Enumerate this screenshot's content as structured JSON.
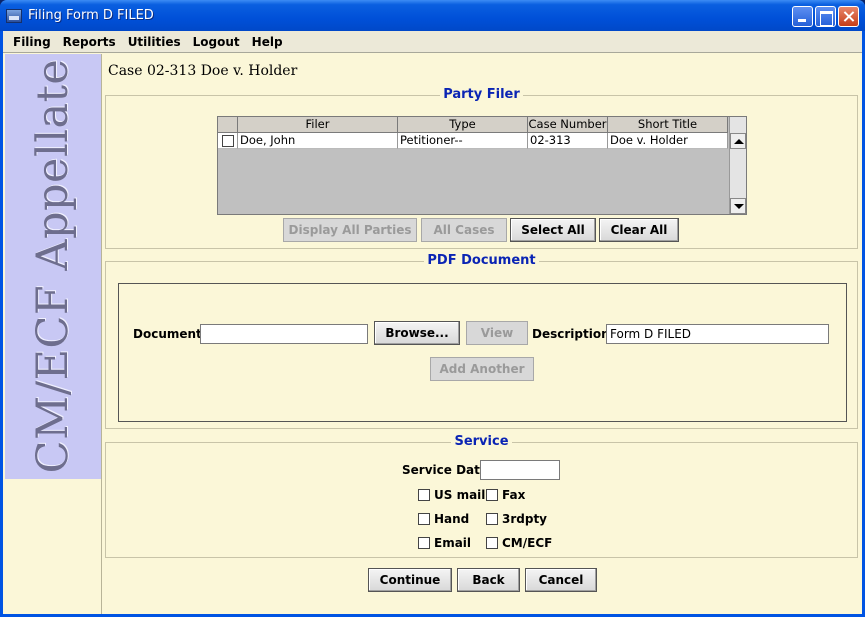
{
  "window": {
    "title": "Filing Form D FILED"
  },
  "menu": [
    "Filing",
    "Reports",
    "Utilities",
    "Logout",
    "Help"
  ],
  "sidebar": {
    "text": "CM/ECF Appellate"
  },
  "case_title": "Case 02-313 Doe v. Holder",
  "party_filer": {
    "legend": "Party Filer",
    "columns": [
      "",
      "Filer",
      "Type",
      "Case Number",
      "Short Title"
    ],
    "rows": [
      {
        "checked": false,
        "filer": "Doe, John",
        "type": "Petitioner--",
        "case_number": "02-313",
        "short_title": "Doe v. Holder"
      }
    ],
    "buttons": {
      "display_all_parties": "Display All Parties",
      "all_cases": "All Cases",
      "select_all": "Select All",
      "clear_all": "Clear All"
    }
  },
  "pdf_document": {
    "legend": "PDF Document",
    "document_label": "Document:",
    "document_value": "",
    "browse": "Browse...",
    "view": "View",
    "description_label": "Description:",
    "description_value": "Form D FILED",
    "add_another": "Add Another"
  },
  "service": {
    "legend": "Service",
    "date_label": "Service Date:",
    "date_value": "",
    "options": {
      "us_mail": "US mail",
      "fax": "Fax",
      "hand": "Hand",
      "third_party": "3rdpty",
      "email": "Email",
      "cmecf": "CM/ECF"
    }
  },
  "footer": {
    "continue": "Continue",
    "back": "Back",
    "cancel": "Cancel"
  },
  "colors": {
    "titlebar": "#0054e3",
    "background": "#fbf7d8",
    "sidebar": "#c8c8f4",
    "legend": "#0a24b4"
  }
}
